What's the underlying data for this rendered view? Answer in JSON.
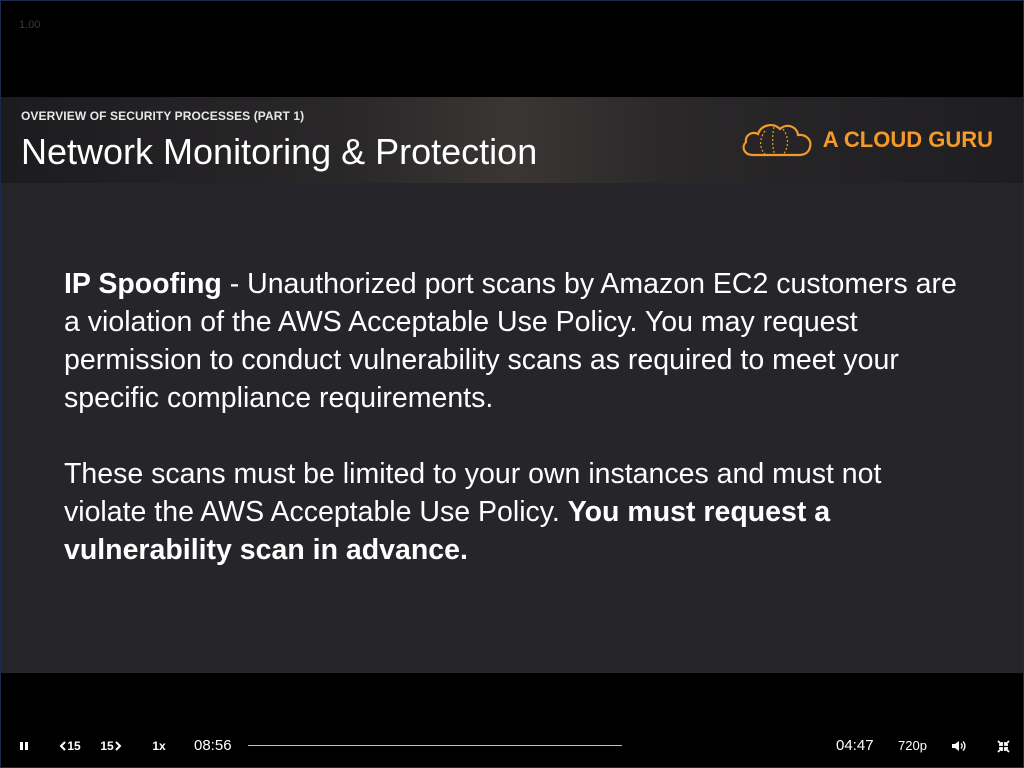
{
  "player": {
    "speed_indicator": "1.00",
    "controls": {
      "pause_icon": "pause-icon",
      "rewind_label": "15",
      "forward_label": "15",
      "playback_rate": "1x",
      "current_time": "08:56",
      "remaining_time": "04:47",
      "quality": "720p",
      "volume_icon": "volume-icon",
      "exit_fullscreen_icon": "exit-fullscreen-icon",
      "progress": 0.0
    }
  },
  "slide": {
    "subtitle": "OVERVIEW OF SECURITY PROCESSES (PART 1)",
    "title": "Network Monitoring & Protection",
    "brand_name": "A CLOUD GURU",
    "brand_color": "#f39a2b",
    "paragraph1": {
      "bold_lead": "IP Spoofing",
      "text": " - Unauthorized port scans by Amazon EC2 customers are a violation of the AWS Acceptable Use Policy. You may request permission to conduct vulnerability scans as required to meet your specific compliance requirements."
    },
    "paragraph2": {
      "text": "These scans must be limited to your own instances and must not violate the AWS Acceptable Use Policy. ",
      "bold_tail": "You must request a vulnerability scan in advance."
    }
  }
}
